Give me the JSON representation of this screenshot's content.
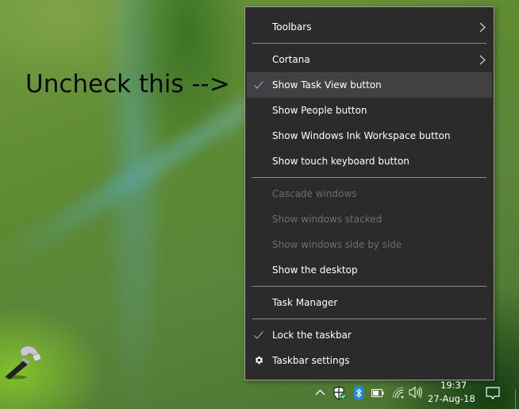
{
  "annotation": {
    "text": "Uncheck this -->"
  },
  "context_menu": {
    "items": [
      {
        "label": "Toolbars",
        "submenu": true
      },
      {
        "separator": true
      },
      {
        "label": "Cortana",
        "submenu": true
      },
      {
        "label": "Show Task View button",
        "checked": true,
        "highlighted": true
      },
      {
        "label": "Show People button"
      },
      {
        "label": "Show Windows Ink Workspace button"
      },
      {
        "label": "Show touch keyboard button"
      },
      {
        "separator": true
      },
      {
        "label": "Cascade windows",
        "disabled": true
      },
      {
        "label": "Show windows stacked",
        "disabled": true
      },
      {
        "label": "Show windows side by side",
        "disabled": true
      },
      {
        "label": "Show the desktop"
      },
      {
        "separator": true
      },
      {
        "label": "Task Manager"
      },
      {
        "separator": true
      },
      {
        "label": "Lock the taskbar",
        "checked": true
      },
      {
        "label": "Taskbar settings",
        "icon": "gear-icon"
      }
    ],
    "colors": {
      "background": "#2b2b2b",
      "highlight": "#414141",
      "text": "#ffffff",
      "disabled_text": "#6d6d6d",
      "check": "#7fa8d8"
    }
  },
  "taskbar": {
    "tray_icons": [
      "chevron-up-icon",
      "windows-defender-icon",
      "bluetooth-icon",
      "battery-icon",
      "wifi-icon",
      "volume-icon"
    ],
    "clock": {
      "time": "19:37",
      "date": "27-Aug-18"
    },
    "action_center_icon": "notification-icon"
  }
}
